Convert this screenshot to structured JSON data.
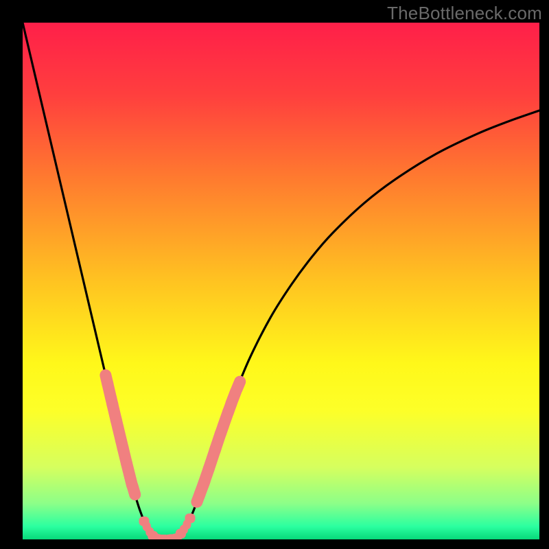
{
  "watermark": "TheBottleneck.com",
  "chart_data": {
    "type": "line",
    "title": "",
    "xlabel": "",
    "ylabel": "",
    "xlim": [
      0,
      1
    ],
    "ylim": [
      0,
      1
    ],
    "gradient_stops": [
      {
        "offset": 0.0,
        "color": "#ff1f49"
      },
      {
        "offset": 0.14,
        "color": "#ff3f3e"
      },
      {
        "offset": 0.3,
        "color": "#ff7a2f"
      },
      {
        "offset": 0.5,
        "color": "#ffc321"
      },
      {
        "offset": 0.66,
        "color": "#fff81a"
      },
      {
        "offset": 0.75,
        "color": "#fdff28"
      },
      {
        "offset": 0.86,
        "color": "#d6ff5e"
      },
      {
        "offset": 0.93,
        "color": "#8dff88"
      },
      {
        "offset": 0.975,
        "color": "#2bffa0"
      },
      {
        "offset": 1.0,
        "color": "#07d97a"
      }
    ],
    "series": [
      {
        "name": "left-branch",
        "x": [
          0.0,
          0.02,
          0.04,
          0.06,
          0.08,
          0.1,
          0.12,
          0.14,
          0.16,
          0.18,
          0.2,
          0.205,
          0.21,
          0.215,
          0.22,
          0.225,
          0.23,
          0.235,
          0.24,
          0.245,
          0.25,
          0.255
        ],
        "y": [
          0.0,
          0.085,
          0.17,
          0.255,
          0.34,
          0.425,
          0.51,
          0.595,
          0.68,
          0.765,
          0.848,
          0.868,
          0.888,
          0.905,
          0.922,
          0.938,
          0.952,
          0.965,
          0.975,
          0.984,
          0.991,
          0.996
        ]
      },
      {
        "name": "trough",
        "x": [
          0.255,
          0.26,
          0.265,
          0.27,
          0.275,
          0.28,
          0.285,
          0.29,
          0.295,
          0.3
        ],
        "y": [
          0.996,
          0.998,
          0.9995,
          1.0,
          1.0,
          1.0,
          0.9995,
          0.999,
          0.998,
          0.996
        ]
      },
      {
        "name": "right-branch",
        "x": [
          0.3,
          0.31,
          0.32,
          0.33,
          0.34,
          0.35,
          0.36,
          0.37,
          0.38,
          0.395,
          0.41,
          0.44,
          0.48,
          0.52,
          0.56,
          0.6,
          0.66,
          0.72,
          0.8,
          0.88,
          0.94,
          1.0
        ],
        "y": [
          0.996,
          0.984,
          0.968,
          0.946,
          0.92,
          0.893,
          0.864,
          0.834,
          0.804,
          0.761,
          0.72,
          0.648,
          0.57,
          0.507,
          0.453,
          0.407,
          0.35,
          0.304,
          0.254,
          0.215,
          0.191,
          0.17
        ]
      }
    ],
    "marker_band": {
      "ymin": 0.69,
      "ymax": 0.92
    },
    "trough_markers_x": [
      0.235,
      0.24,
      0.246,
      0.252,
      0.258,
      0.264,
      0.27,
      0.276,
      0.282,
      0.288,
      0.294,
      0.3,
      0.306,
      0.312,
      0.318,
      0.324
    ]
  }
}
